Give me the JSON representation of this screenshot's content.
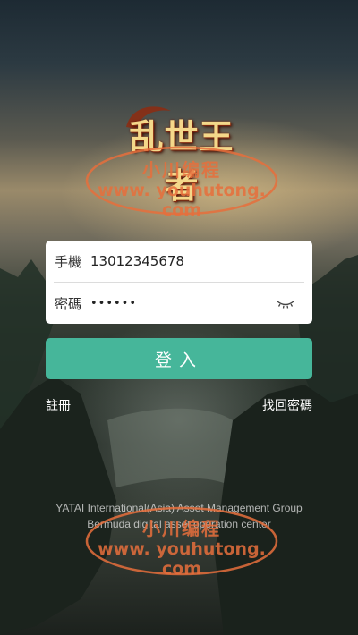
{
  "logo": {
    "text": "乱世王者"
  },
  "watermark": {
    "line1": "小川编程",
    "line2": "www. youhutong. com"
  },
  "form": {
    "phone_label": "手機",
    "phone_value": "13012345678",
    "password_label": "密碼",
    "password_value": "••••••"
  },
  "actions": {
    "login_label": "登入",
    "register_label": "註冊",
    "forgot_label": "找回密碼"
  },
  "footer": {
    "line1": "YATAI International(Asia) Asset Management Group",
    "line2": "Bermuda digital asset operation center"
  },
  "colors": {
    "accent": "#46b69a",
    "watermark": "#e66e3c"
  },
  "icons": {
    "password_toggle": "eye-closed-icon"
  }
}
